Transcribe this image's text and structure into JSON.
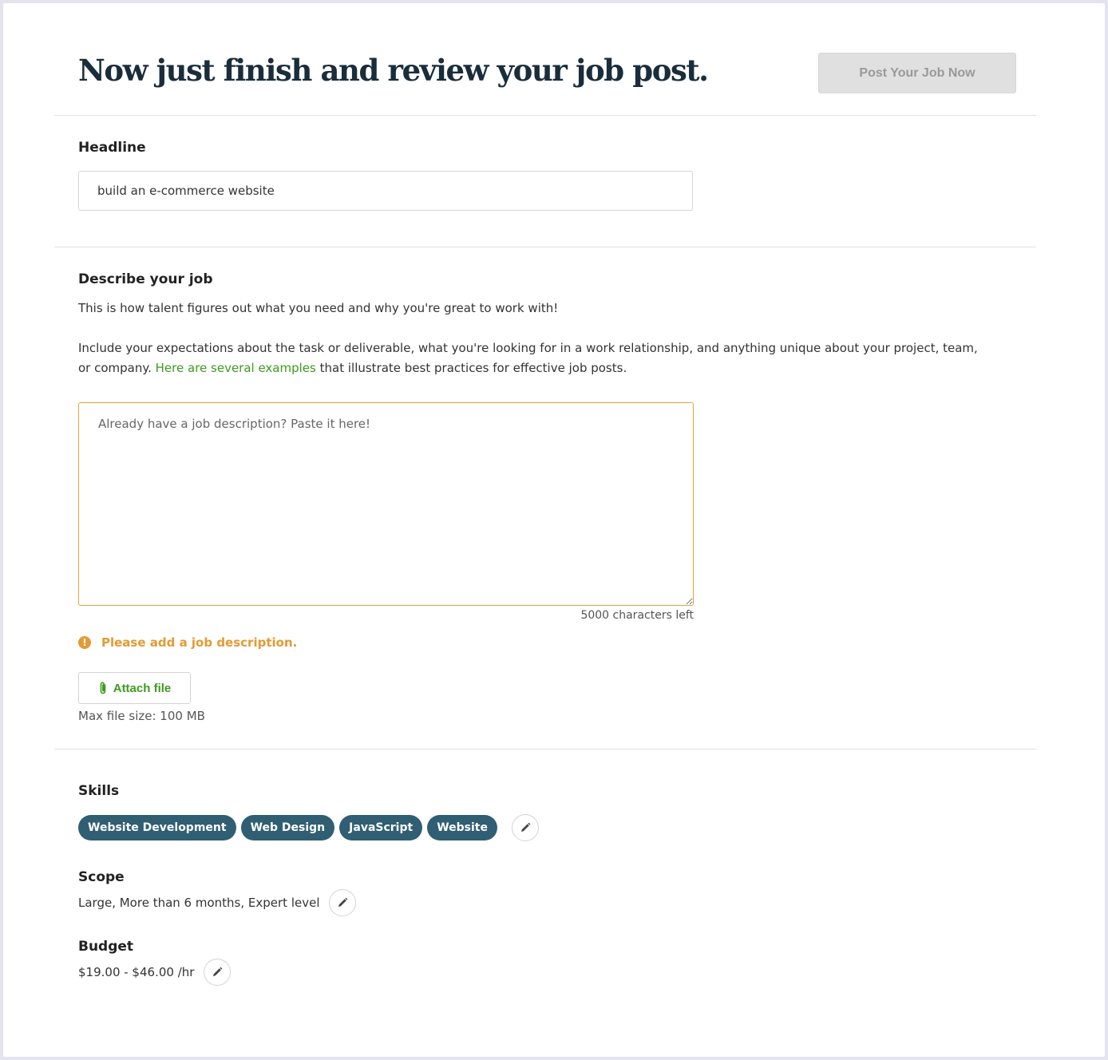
{
  "header": {
    "title": "Now just finish and review your job post.",
    "post_button": "Post Your Job Now"
  },
  "headline": {
    "label": "Headline",
    "value": "build an e-commerce website"
  },
  "description": {
    "label": "Describe your job",
    "intro": "This is how talent figures out what you need and why you're great to work with!",
    "guidance_before_link": "Include your expectations about the task or deliverable, what you're looking for in a work relationship, and anything unique about your project, team, or company. ",
    "guidance_link": "Here are several examples",
    "guidance_after_link": " that illustrate best practices for effective job posts.",
    "placeholder": "Already have a job description? Paste it here!",
    "value": "",
    "counter": "5000 characters left",
    "warning": "Please add a job description.",
    "attach_label": "Attach file",
    "max_file_size": "Max file size: 100 MB"
  },
  "skills": {
    "label": "Skills",
    "items": [
      "Website Development",
      "Web Design",
      "JavaScript",
      "Website"
    ]
  },
  "scope": {
    "label": "Scope",
    "value": "Large, More than 6 months, Expert level"
  },
  "budget": {
    "label": "Budget",
    "value": "$19.00 - $46.00 /hr"
  },
  "icons": {
    "edit": "pencil-icon",
    "attach": "paperclip-icon",
    "warning": "exclamation-circle-icon"
  },
  "colors": {
    "title": "#1a2d3b",
    "accent_green": "#3d9b1e",
    "warning_orange": "#e49a34",
    "chip_bg": "#305e73",
    "disabled_button_bg": "#e0e0e0"
  }
}
